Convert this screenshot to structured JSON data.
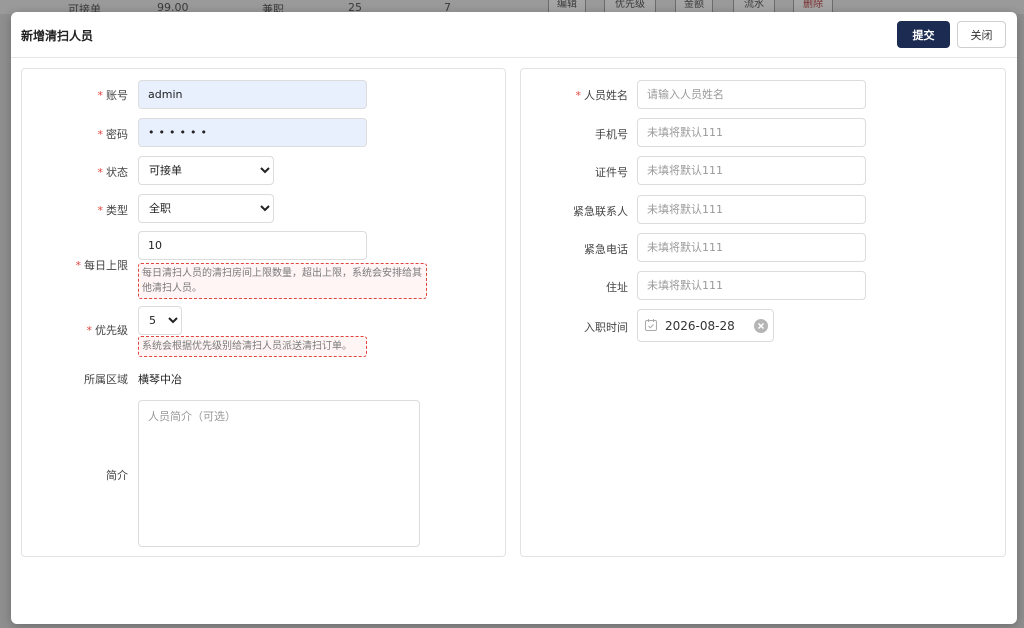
{
  "background": {
    "row_cells": [
      "可接单",
      "99.00",
      "兼职",
      "25",
      "7"
    ],
    "row_buttons": [
      "编辑",
      "优先级",
      "金额",
      "流水",
      "删除"
    ]
  },
  "modal": {
    "title": "新增清扫人员",
    "submit_label": "提交",
    "close_label": "关闭"
  },
  "left": {
    "account": {
      "label": "账号",
      "value": "admin"
    },
    "password": {
      "label": "密码",
      "value": "••••••"
    },
    "status": {
      "label": "状态",
      "selected": "可接单"
    },
    "type": {
      "label": "类型",
      "selected": "全职"
    },
    "daily_limit": {
      "label": "每日上限",
      "value": "10",
      "hint": "每日清扫人员的清扫房间上限数量，超出上限，系统会安排给其他清扫人员。"
    },
    "priority": {
      "label": "优先级",
      "selected": "5",
      "hint": "系统会根据优先级别给清扫人员派送清扫订单。"
    },
    "region": {
      "label": "所属区域",
      "value": "横琴中冶"
    },
    "intro": {
      "label": "简介",
      "placeholder": "人员简介（可选）"
    }
  },
  "right": {
    "name": {
      "label": "人员姓名",
      "placeholder": "请输入人员姓名"
    },
    "phone": {
      "label": "手机号",
      "placeholder": "未填将默认111"
    },
    "id_number": {
      "label": "证件号",
      "placeholder": "未填将默认111"
    },
    "emergency_contact": {
      "label": "紧急联系人",
      "placeholder": "未填将默认111"
    },
    "emergency_phone": {
      "label": "紧急电话",
      "placeholder": "未填将默认111"
    },
    "address": {
      "label": "住址",
      "placeholder": "未填将默认111"
    },
    "join_date": {
      "label": "入职时间",
      "value": "2026-08-28"
    }
  },
  "colors": {
    "primary": "#1c2b52",
    "required": "#e0443e",
    "autofill": "#e8f0fe"
  },
  "icons": [
    "calendar-icon",
    "clear-icon",
    "chevron-down-icon"
  ]
}
